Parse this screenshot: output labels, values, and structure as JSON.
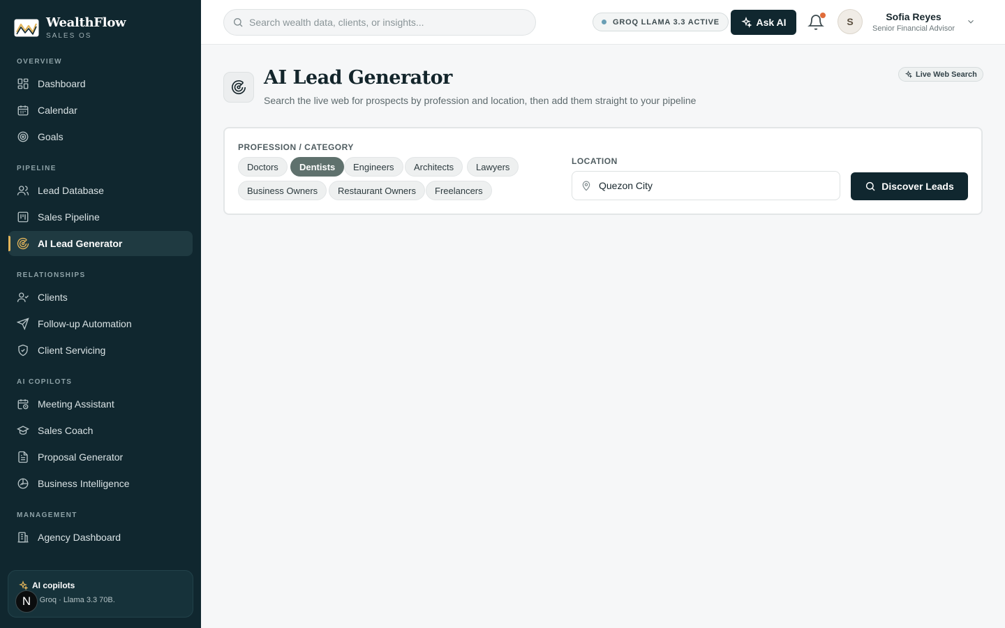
{
  "brand": {
    "name": "WealthFlow",
    "sub": "SALES OS"
  },
  "sidebar": {
    "sections": [
      {
        "title": "OVERVIEW",
        "items": [
          {
            "label": "Dashboard",
            "icon": "grid-icon"
          },
          {
            "label": "Calendar",
            "icon": "calendar-icon"
          },
          {
            "label": "Goals",
            "icon": "target-icon"
          }
        ]
      },
      {
        "title": "PIPELINE",
        "items": [
          {
            "label": "Lead Database",
            "icon": "users-icon"
          },
          {
            "label": "Sales Pipeline",
            "icon": "kanban-icon"
          },
          {
            "label": "AI Lead Generator",
            "icon": "radar-icon",
            "active": true
          }
        ]
      },
      {
        "title": "RELATIONSHIPS",
        "items": [
          {
            "label": "Clients",
            "icon": "user-check-icon"
          },
          {
            "label": "Follow-up Automation",
            "icon": "send-icon"
          },
          {
            "label": "Client Servicing",
            "icon": "shield-icon"
          }
        ]
      },
      {
        "title": "AI COPILOTS",
        "items": [
          {
            "label": "Meeting Assistant",
            "icon": "calendar-clock-icon"
          },
          {
            "label": "Sales Coach",
            "icon": "graduation-cap-icon"
          },
          {
            "label": "Proposal Generator",
            "icon": "file-text-icon"
          },
          {
            "label": "Business Intelligence",
            "icon": "chart-pie-icon"
          }
        ]
      },
      {
        "title": "MANAGEMENT",
        "items": [
          {
            "label": "Agency Dashboard",
            "icon": "building-icon"
          }
        ]
      }
    ],
    "copilot_card": {
      "title": "AI copilots",
      "sub": "ng on Groq · Llama 3.3 70B.",
      "badge": "N"
    }
  },
  "topbar": {
    "search_placeholder": "Search wealth data, clients, or insights...",
    "groq_status": "GROQ LLAMA 3.3 ACTIVE",
    "ask_ai": "Ask AI",
    "user": {
      "initial": "S",
      "name": "Sofia Reyes",
      "role": "Senior Financial Advisor"
    }
  },
  "page": {
    "title": "AI Lead Generator",
    "subtitle": "Search the live web for prospects by profession and location, then add them straight to your pipeline",
    "badge": "Live Web Search"
  },
  "form": {
    "profession_label": "PROFESSION / CATEGORY",
    "professions": [
      "Doctors",
      "Dentists",
      "Engineers",
      "Architects",
      "Lawyers",
      "Business Owners",
      "Restaurant Owners",
      "Freelancers"
    ],
    "selected_profession": "Dentists",
    "location_label": "LOCATION",
    "location_value": "Quezon City",
    "discover_button": "Discover Leads"
  },
  "colors": {
    "sidebar_bg": "#10272f",
    "accent_gold": "#e2b45a",
    "selected_chip": "#5f716d",
    "notification": "#e06c3a"
  }
}
